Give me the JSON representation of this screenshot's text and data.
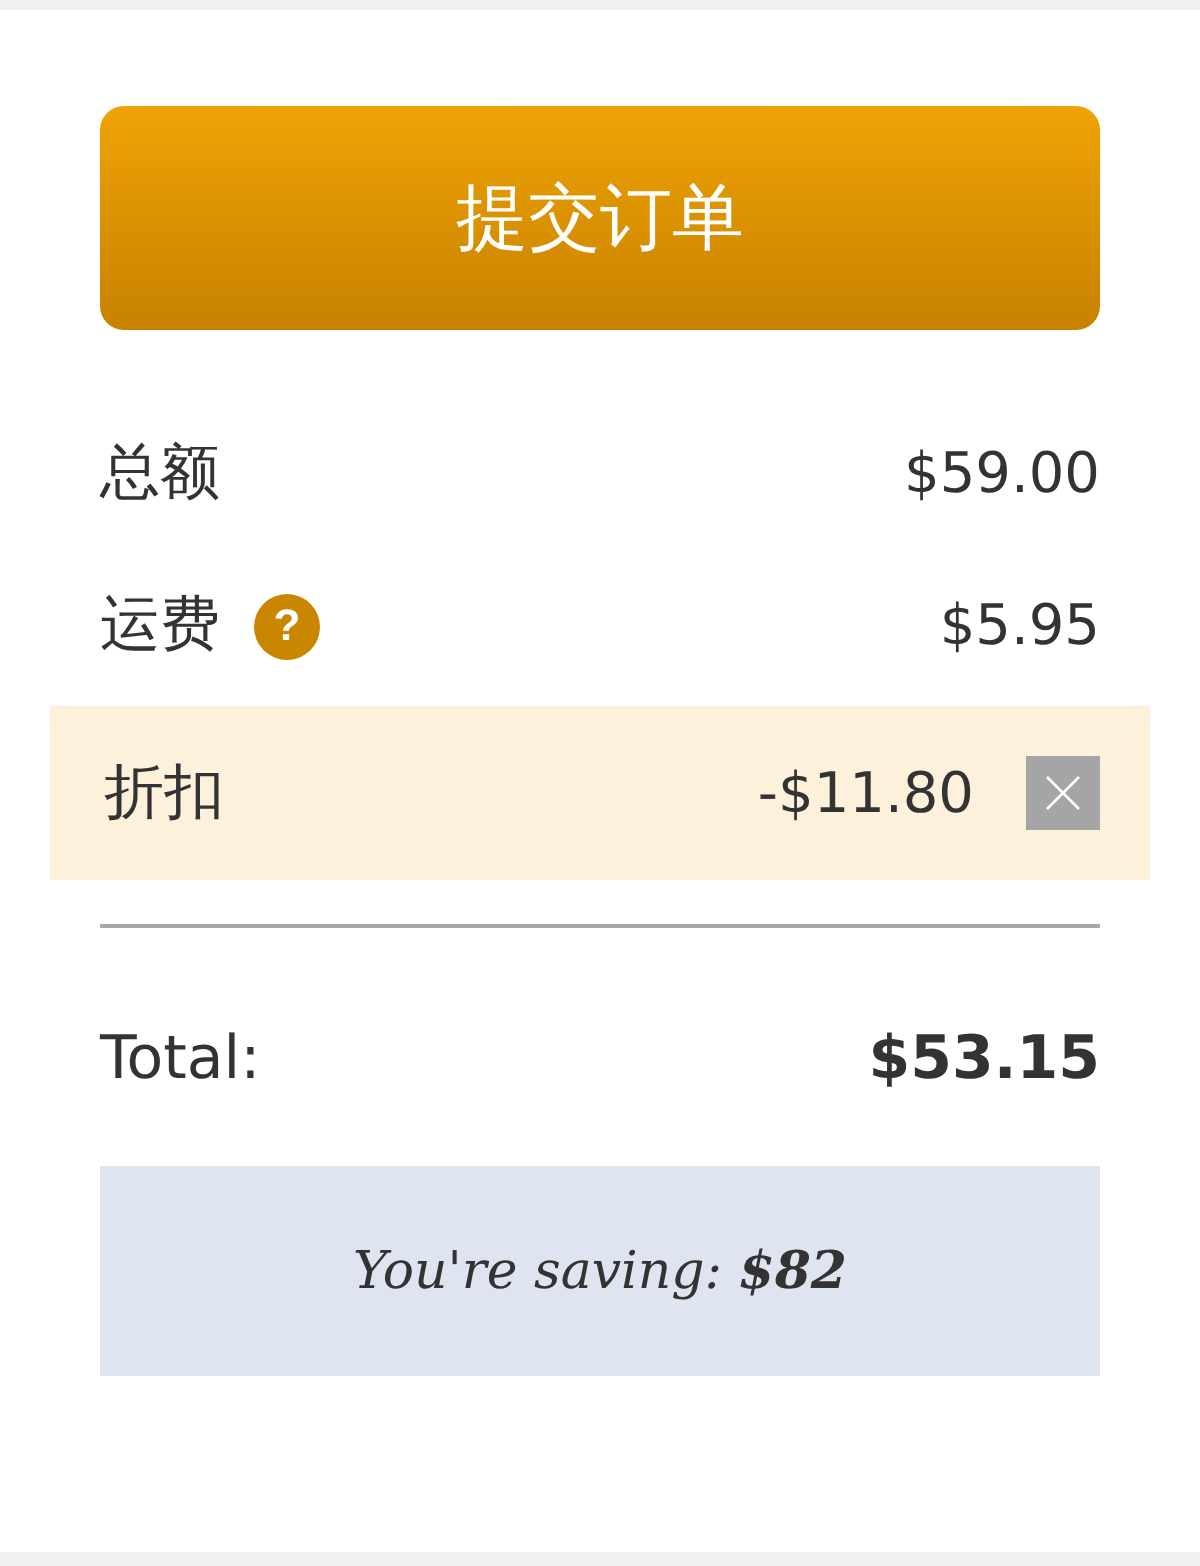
{
  "submit_button": {
    "label": "提交订单"
  },
  "summary_rows": [
    {
      "kind": "plain",
      "label": "总额",
      "value": "$59.00"
    },
    {
      "kind": "help",
      "label": "运费",
      "help_icon": "?",
      "value": "$5.95"
    },
    {
      "kind": "discount",
      "label": "折扣",
      "value": "-$11.80"
    }
  ],
  "total": {
    "label": "Total:",
    "value": "$53.15"
  },
  "savings": {
    "text": "You're saving: **$82**"
  }
}
